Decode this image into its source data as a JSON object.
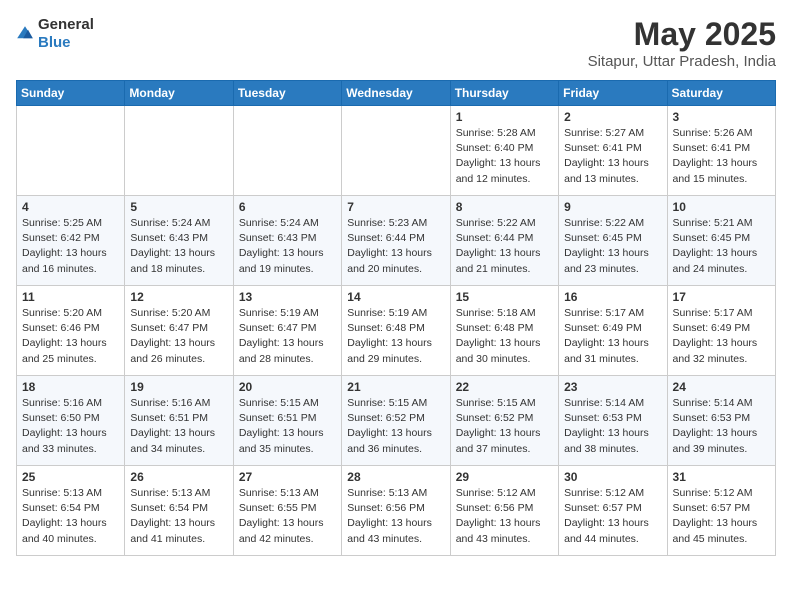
{
  "logo": {
    "general": "General",
    "blue": "Blue"
  },
  "title": "May 2025",
  "subtitle": "Sitapur, Uttar Pradesh, India",
  "weekdays": [
    "Sunday",
    "Monday",
    "Tuesday",
    "Wednesday",
    "Thursday",
    "Friday",
    "Saturday"
  ],
  "weeks": [
    [
      {
        "day": "",
        "info": ""
      },
      {
        "day": "",
        "info": ""
      },
      {
        "day": "",
        "info": ""
      },
      {
        "day": "",
        "info": ""
      },
      {
        "day": "1",
        "info": "Sunrise: 5:28 AM\nSunset: 6:40 PM\nDaylight: 13 hours\nand 12 minutes."
      },
      {
        "day": "2",
        "info": "Sunrise: 5:27 AM\nSunset: 6:41 PM\nDaylight: 13 hours\nand 13 minutes."
      },
      {
        "day": "3",
        "info": "Sunrise: 5:26 AM\nSunset: 6:41 PM\nDaylight: 13 hours\nand 15 minutes."
      }
    ],
    [
      {
        "day": "4",
        "info": "Sunrise: 5:25 AM\nSunset: 6:42 PM\nDaylight: 13 hours\nand 16 minutes."
      },
      {
        "day": "5",
        "info": "Sunrise: 5:24 AM\nSunset: 6:43 PM\nDaylight: 13 hours\nand 18 minutes."
      },
      {
        "day": "6",
        "info": "Sunrise: 5:24 AM\nSunset: 6:43 PM\nDaylight: 13 hours\nand 19 minutes."
      },
      {
        "day": "7",
        "info": "Sunrise: 5:23 AM\nSunset: 6:44 PM\nDaylight: 13 hours\nand 20 minutes."
      },
      {
        "day": "8",
        "info": "Sunrise: 5:22 AM\nSunset: 6:44 PM\nDaylight: 13 hours\nand 21 minutes."
      },
      {
        "day": "9",
        "info": "Sunrise: 5:22 AM\nSunset: 6:45 PM\nDaylight: 13 hours\nand 23 minutes."
      },
      {
        "day": "10",
        "info": "Sunrise: 5:21 AM\nSunset: 6:45 PM\nDaylight: 13 hours\nand 24 minutes."
      }
    ],
    [
      {
        "day": "11",
        "info": "Sunrise: 5:20 AM\nSunset: 6:46 PM\nDaylight: 13 hours\nand 25 minutes."
      },
      {
        "day": "12",
        "info": "Sunrise: 5:20 AM\nSunset: 6:47 PM\nDaylight: 13 hours\nand 26 minutes."
      },
      {
        "day": "13",
        "info": "Sunrise: 5:19 AM\nSunset: 6:47 PM\nDaylight: 13 hours\nand 28 minutes."
      },
      {
        "day": "14",
        "info": "Sunrise: 5:19 AM\nSunset: 6:48 PM\nDaylight: 13 hours\nand 29 minutes."
      },
      {
        "day": "15",
        "info": "Sunrise: 5:18 AM\nSunset: 6:48 PM\nDaylight: 13 hours\nand 30 minutes."
      },
      {
        "day": "16",
        "info": "Sunrise: 5:17 AM\nSunset: 6:49 PM\nDaylight: 13 hours\nand 31 minutes."
      },
      {
        "day": "17",
        "info": "Sunrise: 5:17 AM\nSunset: 6:49 PM\nDaylight: 13 hours\nand 32 minutes."
      }
    ],
    [
      {
        "day": "18",
        "info": "Sunrise: 5:16 AM\nSunset: 6:50 PM\nDaylight: 13 hours\nand 33 minutes."
      },
      {
        "day": "19",
        "info": "Sunrise: 5:16 AM\nSunset: 6:51 PM\nDaylight: 13 hours\nand 34 minutes."
      },
      {
        "day": "20",
        "info": "Sunrise: 5:15 AM\nSunset: 6:51 PM\nDaylight: 13 hours\nand 35 minutes."
      },
      {
        "day": "21",
        "info": "Sunrise: 5:15 AM\nSunset: 6:52 PM\nDaylight: 13 hours\nand 36 minutes."
      },
      {
        "day": "22",
        "info": "Sunrise: 5:15 AM\nSunset: 6:52 PM\nDaylight: 13 hours\nand 37 minutes."
      },
      {
        "day": "23",
        "info": "Sunrise: 5:14 AM\nSunset: 6:53 PM\nDaylight: 13 hours\nand 38 minutes."
      },
      {
        "day": "24",
        "info": "Sunrise: 5:14 AM\nSunset: 6:53 PM\nDaylight: 13 hours\nand 39 minutes."
      }
    ],
    [
      {
        "day": "25",
        "info": "Sunrise: 5:13 AM\nSunset: 6:54 PM\nDaylight: 13 hours\nand 40 minutes."
      },
      {
        "day": "26",
        "info": "Sunrise: 5:13 AM\nSunset: 6:54 PM\nDaylight: 13 hours\nand 41 minutes."
      },
      {
        "day": "27",
        "info": "Sunrise: 5:13 AM\nSunset: 6:55 PM\nDaylight: 13 hours\nand 42 minutes."
      },
      {
        "day": "28",
        "info": "Sunrise: 5:13 AM\nSunset: 6:56 PM\nDaylight: 13 hours\nand 43 minutes."
      },
      {
        "day": "29",
        "info": "Sunrise: 5:12 AM\nSunset: 6:56 PM\nDaylight: 13 hours\nand 43 minutes."
      },
      {
        "day": "30",
        "info": "Sunrise: 5:12 AM\nSunset: 6:57 PM\nDaylight: 13 hours\nand 44 minutes."
      },
      {
        "day": "31",
        "info": "Sunrise: 5:12 AM\nSunset: 6:57 PM\nDaylight: 13 hours\nand 45 minutes."
      }
    ]
  ]
}
